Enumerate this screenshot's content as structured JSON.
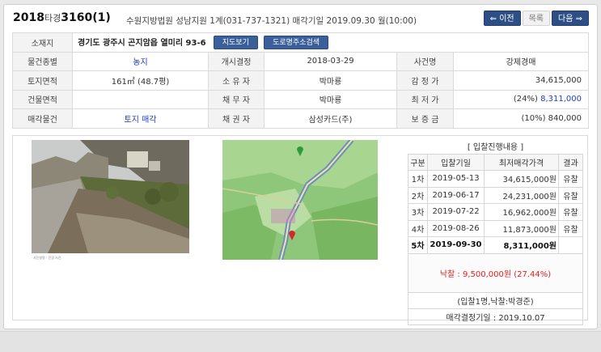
{
  "header": {
    "case_year": "2018",
    "case_type": "타경",
    "case_number": "3160",
    "case_item": "(1)",
    "court_info": "수원지방법원 성남지원 1계(031-737-1321) 매각기일 2019.09.30 월(10:00)",
    "prev_label": "이전",
    "list_label": "목록",
    "next_label": "다음"
  },
  "info": {
    "location_label": "소재지",
    "address": "경기도 광주시 곤지암읍 열미리 93-6",
    "map_btn": "지도보기",
    "road_btn": "도로명주소검색",
    "rows": [
      [
        "물건종별",
        "농지",
        "개시결정",
        "2018-03-29",
        "사건명",
        "강제경매"
      ],
      [
        "토지면적",
        "161㎡ (48.7평)",
        "소 유 자",
        "박마룡",
        "감 정 가",
        "34,615,000"
      ],
      [
        "건물면적",
        "",
        "채 무 자",
        "박마룡",
        "최 저 가",
        "(24%) 8,311,000"
      ],
      [
        "매각물건",
        "토지 매각",
        "채 권 자",
        "삼성카드(주)",
        "보 증 금",
        "(10%) 840,000"
      ]
    ],
    "min_price_pct": "(24%)",
    "min_price_val": "8,311,000"
  },
  "bid_history": {
    "title": "[ 입찰진행내용 ]",
    "columns": [
      "구분",
      "입찰기일",
      "최저매각가격",
      "결과"
    ],
    "rows": [
      [
        "1차",
        "2019-05-13",
        "34,615,000원",
        "유찰"
      ],
      [
        "2차",
        "2019-06-17",
        "24,231,000원",
        "유찰"
      ],
      [
        "3차",
        "2019-07-22",
        "16,962,000원",
        "유찰"
      ],
      [
        "4차",
        "2019-08-26",
        "11,873,000원",
        "유찰"
      ],
      [
        "5차",
        "2019-09-30",
        "8,311,000원",
        ""
      ]
    ],
    "winning_bid": "낙찰 : 9,500,000원  (27.44%)",
    "bidders": "(입찰1명,낙찰:박경준)",
    "decision_date": "매각결정기일 : 2019.10.07"
  },
  "photo": {
    "caption": "사진설명 : 전경 사진"
  },
  "colors": {
    "accent": "#2d4f86",
    "link": "#2040c0",
    "result": "#e02020"
  }
}
